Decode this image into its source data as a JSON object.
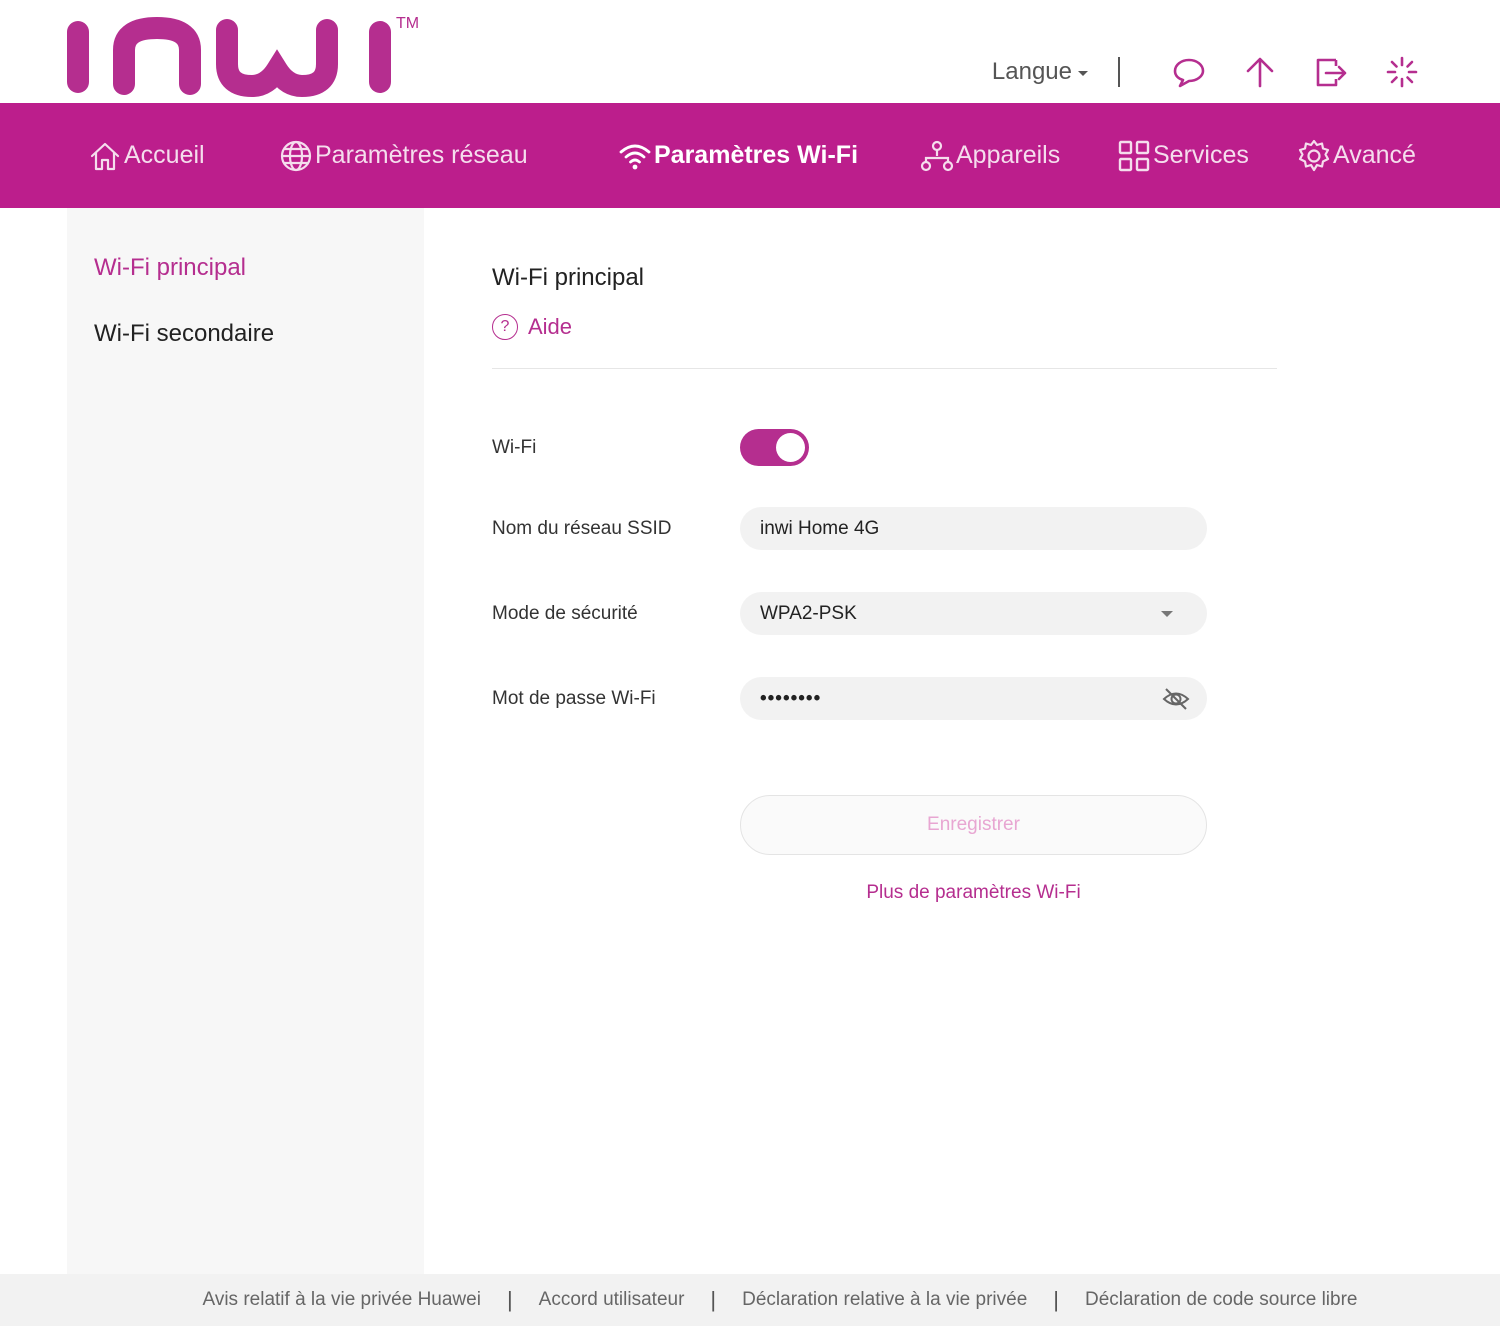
{
  "brand": {
    "name": "inwi",
    "trademark": "TM",
    "color": "#b52e8f"
  },
  "header": {
    "language_label": "Langue",
    "icons": [
      "chat-icon",
      "upload-icon",
      "logout-icon",
      "loading-icon"
    ]
  },
  "nav": {
    "items": [
      {
        "label": "Accueil",
        "icon": "home-icon"
      },
      {
        "label": "Paramètres réseau",
        "icon": "globe-icon"
      },
      {
        "label": "Paramètres Wi-Fi",
        "icon": "wifi-icon",
        "active": true
      },
      {
        "label": "Appareils",
        "icon": "devices-icon"
      },
      {
        "label": "Services",
        "icon": "grid-icon"
      },
      {
        "label": "Avancé",
        "icon": "settings-icon"
      }
    ],
    "background": "#bc1e8c"
  },
  "sidebar": {
    "items": [
      {
        "label": "Wi-Fi principal",
        "active": true
      },
      {
        "label": "Wi-Fi secondaire",
        "active": false
      }
    ]
  },
  "main": {
    "title": "Wi-Fi principal",
    "help_label": "Aide",
    "help_glyph": "?",
    "wifi_label": "Wi-Fi",
    "wifi_enabled": true,
    "ssid_label": "Nom du réseau SSID",
    "ssid_value": "inwi Home 4G",
    "security_label": "Mode de sécurité",
    "security_value": "WPA2-PSK",
    "password_label": "Mot de passe Wi-Fi",
    "password_masked": "••••••••",
    "save_label": "Enregistrer",
    "more_link": "Plus de paramètres Wi-Fi"
  },
  "footer": {
    "links": [
      "Avis relatif à la vie privée Huawei",
      "Accord utilisateur",
      "Déclaration relative à la vie privée",
      "Déclaration de code source libre"
    ],
    "separator": "|"
  }
}
